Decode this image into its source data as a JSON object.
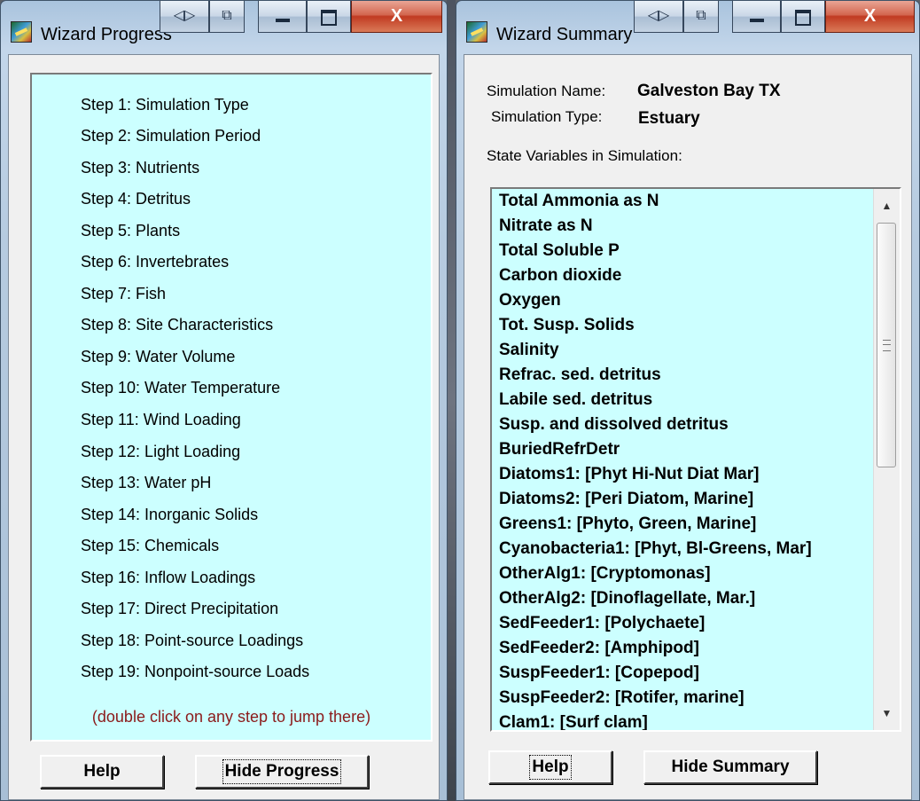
{
  "progress_window": {
    "title": "Wizard Progress",
    "steps": [
      "Step 1: Simulation Type",
      "Step 2: Simulation Period",
      "Step 3: Nutrients",
      "Step 4: Detritus",
      "Step 5: Plants",
      "Step 6: Invertebrates",
      "Step 7: Fish",
      "Step 8: Site Characteristics",
      "Step 9: Water Volume",
      "Step 10: Water Temperature",
      "Step 11: Wind Loading",
      "Step 12: Light Loading",
      "Step 13: Water pH",
      "Step 14: Inorganic Solids",
      "Step 15: Chemicals",
      "Step 16: Inflow Loadings",
      "Step 17: Direct Precipitation",
      "Step 18: Point-source Loadings",
      "Step 19: Nonpoint-source Loads"
    ],
    "hint": "(double click on any step to jump there)",
    "help_label": "Help",
    "hide_label": "Hide Progress"
  },
  "summary_window": {
    "title": "Wizard Summary",
    "sim_name_label": "Simulation Name:",
    "sim_name_value": "Galveston Bay TX",
    "sim_type_label": "Simulation Type:",
    "sim_type_value": "Estuary",
    "state_vars_label": "State Variables in Simulation:",
    "state_variables": [
      "Total Ammonia as N",
      "Nitrate as N",
      "Total Soluble P",
      "Carbon dioxide",
      "Oxygen",
      "Tot. Susp. Solids",
      "Salinity",
      "Refrac. sed. detritus",
      "Labile sed. detritus",
      "Susp. and dissolved detritus",
      "BuriedRefrDetr",
      "Diatoms1: [Phyt Hi-Nut Diat Mar]",
      "Diatoms2: [Peri Diatom, Marine]",
      "Greens1: [Phyto, Green, Marine]",
      "Cyanobacteria1: [Phyt, Bl-Greens, Mar]",
      "OtherAlg1: [Cryptomonas]",
      "OtherAlg2: [Dinoflagellate, Mar.]",
      "SedFeeder1: [Polychaete]",
      "SedFeeder2: [Amphipod]",
      "SuspFeeder1: [Copepod]",
      "SuspFeeder2: [Rotifer, marine]",
      "Clam1: [Surf clam]"
    ],
    "help_label": "Help",
    "hide_label": "Hide Summary"
  },
  "title_buttons": {
    "close_glyph": "X",
    "back_glyph": "◁▷",
    "restore_glyph": "⧉"
  },
  "scrollbar": {
    "up_glyph": "▲",
    "down_glyph": "▼"
  },
  "colors": {
    "list_background": "#ccffff",
    "hint_text": "#8b1a1a",
    "close_button": "#c13a21"
  }
}
